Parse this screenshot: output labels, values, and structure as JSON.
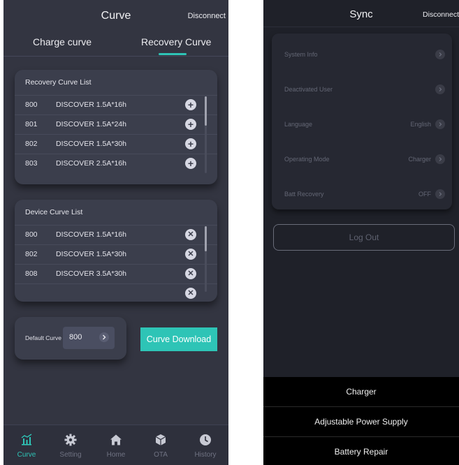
{
  "left_screen": {
    "title": "Curve",
    "disconnect_label": "Disconnect",
    "tabs": [
      {
        "label": "Charge curve",
        "active": false
      },
      {
        "label": "Recovery Curve",
        "active": true
      }
    ],
    "recovery_list": {
      "title": "Recovery Curve List",
      "rows": [
        {
          "code": "800",
          "name": "DISCOVER 1.5A*16h"
        },
        {
          "code": "801",
          "name": "DISCOVER 1.5A*24h"
        },
        {
          "code": "802",
          "name": "DISCOVER 1.5A*30h"
        },
        {
          "code": "803",
          "name": "DISCOVER 2.5A*16h"
        }
      ]
    },
    "device_list": {
      "title": "Device Curve List",
      "rows": [
        {
          "code": "800",
          "name": "DISCOVER 1.5A*16h"
        },
        {
          "code": "802",
          "name": "DISCOVER 1.5A*30h"
        },
        {
          "code": "808",
          "name": "DISCOVER 3.5A*30h"
        }
      ]
    },
    "default_curve": {
      "label": "Default Curve",
      "value": "800"
    },
    "curve_download_label": "Curve Download",
    "nav": [
      {
        "label": "Curve",
        "icon": "curve-chart-icon",
        "active": true
      },
      {
        "label": "Setting",
        "icon": "gear-icon",
        "active": false
      },
      {
        "label": "Home",
        "icon": "home-icon",
        "active": false
      },
      {
        "label": "OTA",
        "icon": "box-icon",
        "active": false
      },
      {
        "label": "History",
        "icon": "clock-icon",
        "active": false
      }
    ]
  },
  "right_screen": {
    "title": "Sync",
    "disconnect_label": "Disconnect",
    "settings": [
      {
        "label": "System Info",
        "value": ""
      },
      {
        "label": "Deactivated User",
        "value": ""
      },
      {
        "label": "Language",
        "value": "English"
      },
      {
        "label": "Operating Mode",
        "value": "Charger"
      },
      {
        "label": "Batt Recovery",
        "value": "OFF"
      }
    ],
    "logout_label": "Log Out",
    "mode_options": [
      "Charger",
      "Adjustable Power Supply",
      "Battery Repair"
    ]
  },
  "colors": {
    "accent": "#2ec4b6",
    "left_background": "#333541",
    "card": "#3b3e4c",
    "right_background": "#1f2129",
    "sheet": "#000000"
  }
}
